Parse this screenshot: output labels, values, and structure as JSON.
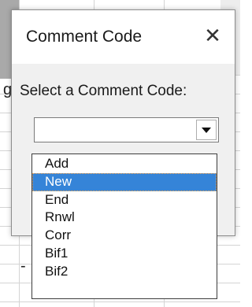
{
  "background": {
    "partial_letter": "g",
    "dash": "-"
  },
  "dialog": {
    "title": "Comment Code",
    "close_glyph": "✕",
    "prompt": "Select a Comment Code:",
    "combo_value": "",
    "options": [
      "Add",
      "New",
      "End",
      "Rnwl",
      "Corr",
      "Bif1",
      "Bif2"
    ],
    "selected_option": "New"
  },
  "colors": {
    "highlight": "#3584d8",
    "focus_outline": "#ffa84c"
  }
}
